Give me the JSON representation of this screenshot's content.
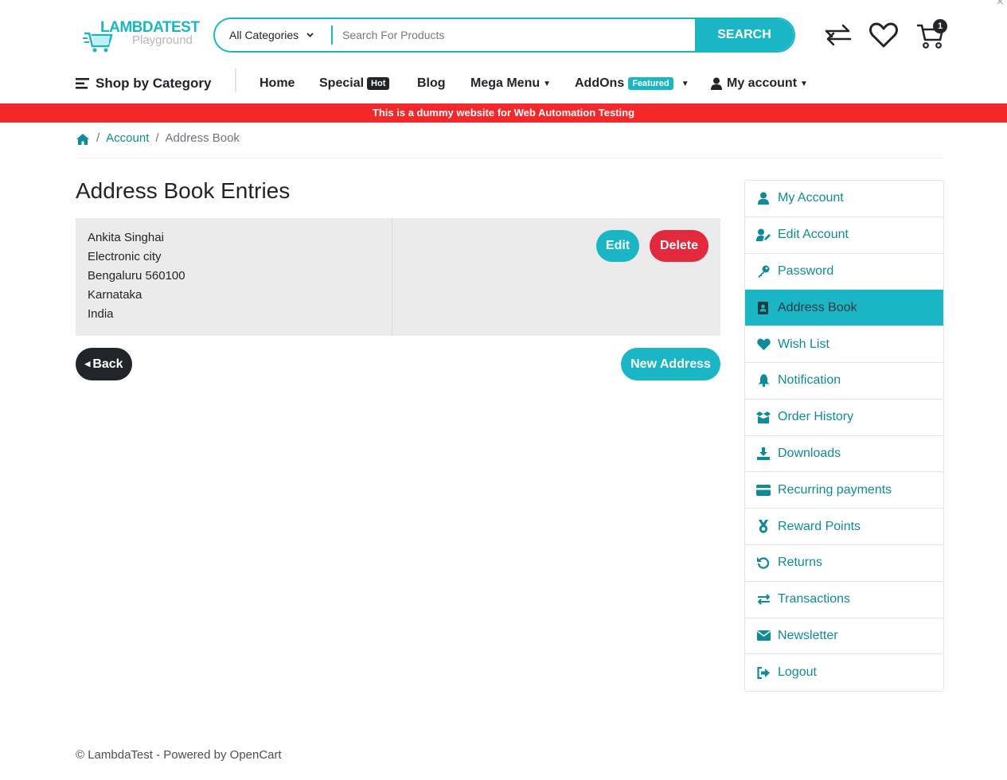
{
  "header": {
    "logo_text": "LAMBDATEST",
    "logo_sub": "Playground",
    "search": {
      "category": "All Categories",
      "placeholder": "Search For Products",
      "button": "SEARCH"
    },
    "cart_count": "1"
  },
  "nav": {
    "shop_by_category": "Shop by Category",
    "home": "Home",
    "special": "Special",
    "special_badge": "Hot",
    "blog": "Blog",
    "mega_menu": "Mega Menu",
    "addons": "AddOns",
    "addons_badge": "Featured",
    "my_account": "My account"
  },
  "banner": "This is a dummy website for Web Automation Testing",
  "breadcrumb": {
    "account": "Account",
    "current": "Address Book"
  },
  "main": {
    "title": "Address Book Entries",
    "address_lines": [
      "Ankita Singhai",
      "Electronic city",
      "Bengaluru 560100",
      "Karnataka",
      "India"
    ],
    "edit": "Edit",
    "delete": "Delete",
    "back": "Back",
    "new_address": "New Address"
  },
  "sidebar": {
    "items": [
      {
        "label": "My Account",
        "icon": "user-icon"
      },
      {
        "label": "Edit Account",
        "icon": "user-edit-icon"
      },
      {
        "label": "Password",
        "icon": "key-icon"
      },
      {
        "label": "Address Book",
        "icon": "address-book-icon",
        "active": true
      },
      {
        "label": "Wish List",
        "icon": "heart-icon"
      },
      {
        "label": "Notification",
        "icon": "bell-icon"
      },
      {
        "label": "Order History",
        "icon": "box-icon"
      },
      {
        "label": "Downloads",
        "icon": "download-icon"
      },
      {
        "label": "Recurring payments",
        "icon": "credit-card-icon"
      },
      {
        "label": "Reward Points",
        "icon": "medal-icon"
      },
      {
        "label": "Returns",
        "icon": "undo-icon"
      },
      {
        "label": "Transactions",
        "icon": "exchange-icon"
      },
      {
        "label": "Newsletter",
        "icon": "envelope-icon"
      },
      {
        "label": "Logout",
        "icon": "sign-out-icon"
      }
    ]
  },
  "footer": "© LambdaTest - Powered by OpenCart",
  "colors": {
    "accent": "#1bb6c6",
    "link": "#0e8b98",
    "banner": "#f3282a",
    "delete": "#e3293d",
    "dark": "#212529"
  }
}
